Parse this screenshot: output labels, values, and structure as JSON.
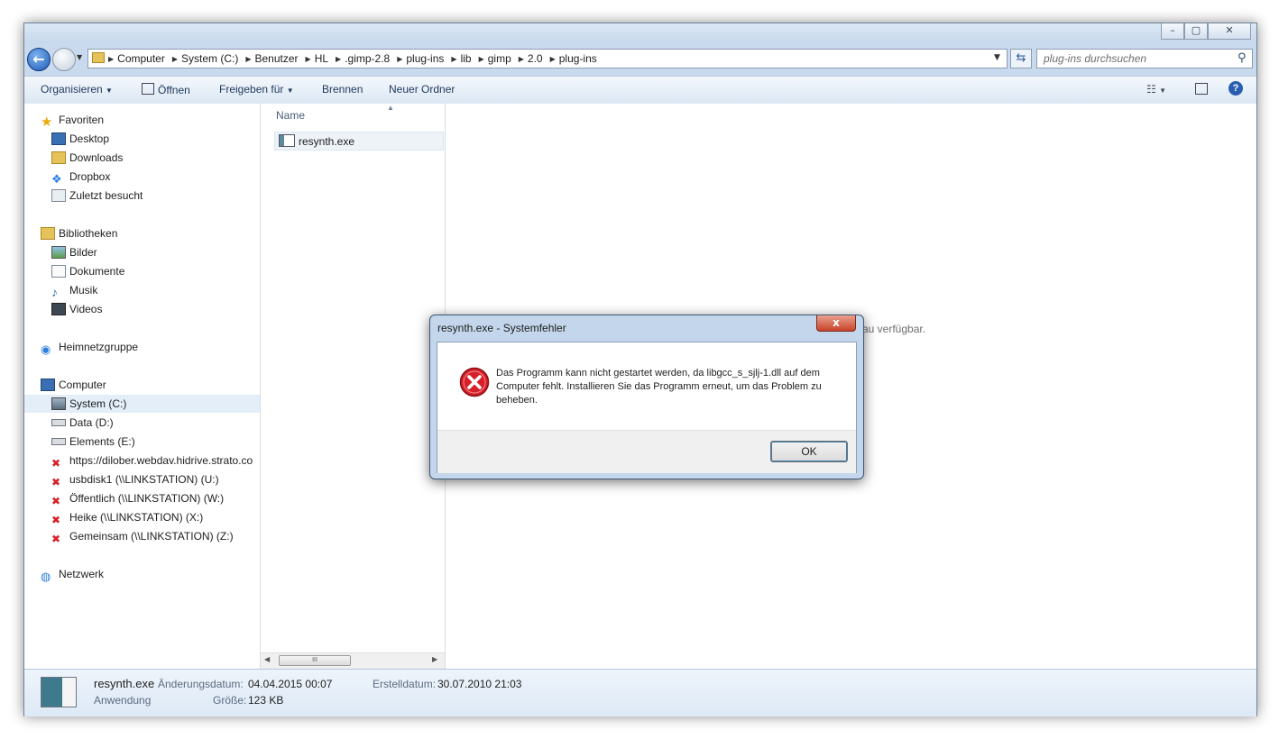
{
  "breadcrumb": [
    "Computer",
    "System (C:)",
    "Benutzer",
    "HL",
    ".gimp-2.8",
    "plug-ins",
    "lib",
    "gimp",
    "2.0",
    "plug-ins"
  ],
  "search": {
    "placeholder": "plug-ins durchsuchen"
  },
  "toolbar": {
    "organize": "Organisieren",
    "open": "Öffnen",
    "share": "Freigeben für",
    "burn": "Brennen",
    "new_folder": "Neuer Ordner"
  },
  "nav": {
    "favorites": {
      "label": "Favoriten",
      "items": [
        "Desktop",
        "Downloads",
        "Dropbox",
        "Zuletzt besucht"
      ]
    },
    "libraries": {
      "label": "Bibliotheken",
      "items": [
        "Bilder",
        "Dokumente",
        "Musik",
        "Videos"
      ]
    },
    "homegroup": "Heimnetzgruppe",
    "computer": {
      "label": "Computer",
      "items": [
        "System (C:)",
        "Data (D:)",
        "Elements (E:)",
        "https://dilober.webdav.hidrive.strato.co",
        "usbdisk1 (\\\\LINKSTATION) (U:)",
        "Öffentlich (\\\\LINKSTATION) (W:)",
        "Heike (\\\\LINKSTATION) (X:)",
        "Gemeinsam (\\\\LINKSTATION) (Z:)"
      ]
    },
    "network": "Netzwerk"
  },
  "filelist": {
    "column": "Name",
    "files": [
      "resynth.exe"
    ],
    "scroll_thumb": "III"
  },
  "preview": {
    "text": "au verfügbar."
  },
  "details": {
    "filename": "resynth.exe",
    "type": "Anwendung",
    "modified_label": "Änderungsdatum:",
    "modified_value": "04.04.2015 00:07",
    "size_label": "Größe:",
    "size_value": "123 KB",
    "created_label": "Erstelldatum:",
    "created_value": "30.07.2010 21:03"
  },
  "dialog": {
    "title": "resynth.exe - Systemfehler",
    "message": "Das Programm kann nicht gestartet werden, da libgcc_s_sjlj-1.dll auf dem Computer fehlt. Installieren Sie das Programm erneut, um das Problem zu beheben.",
    "ok": "OK",
    "close": "x"
  },
  "colors": {
    "error_red": "#d71f27",
    "accent_blue": "#1f5ab8",
    "titlebar": "#c9daee"
  }
}
